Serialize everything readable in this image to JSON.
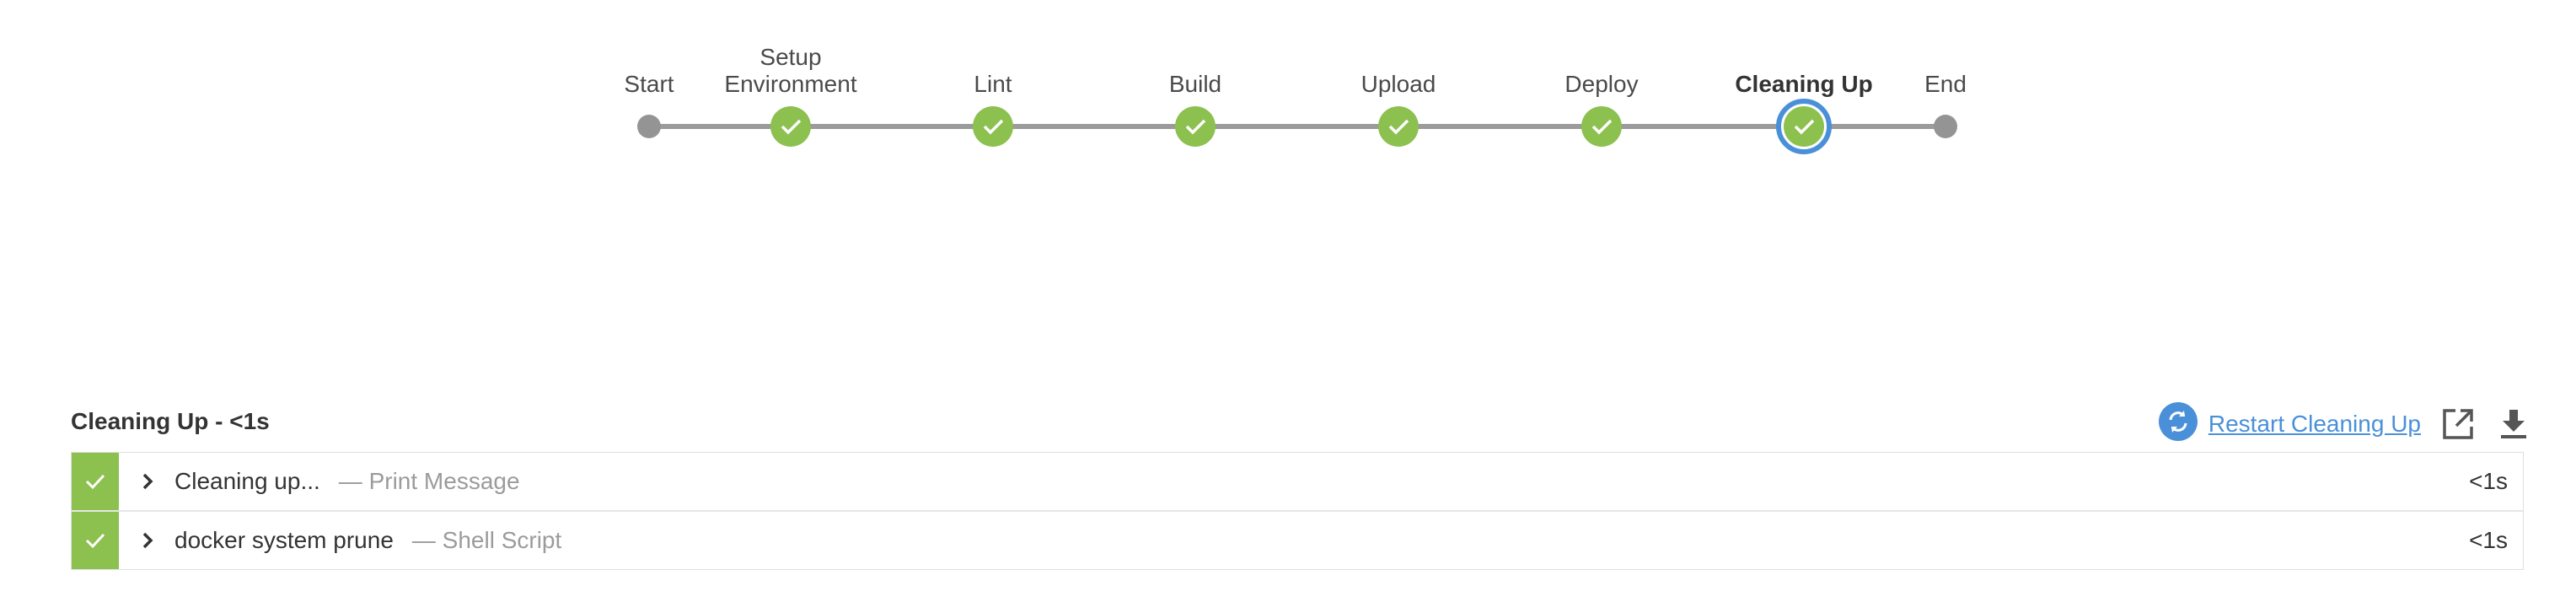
{
  "pipeline": {
    "stages": [
      {
        "label": "Start",
        "kind": "start"
      },
      {
        "label": "Setup\nEnvironment",
        "kind": "success"
      },
      {
        "label": "Lint",
        "kind": "success"
      },
      {
        "label": "Build",
        "kind": "success"
      },
      {
        "label": "Upload",
        "kind": "success"
      },
      {
        "label": "Deploy",
        "kind": "success"
      },
      {
        "label": "Cleaning Up",
        "kind": "success",
        "selected": true
      },
      {
        "label": "End",
        "kind": "end"
      }
    ],
    "colors": {
      "success": "#8cc04f",
      "line": "#9b9b9b",
      "node": "#949494",
      "selected_ring": "#4a90d9"
    }
  },
  "panel": {
    "title": "Cleaning Up - <1s",
    "restart_label": "Restart Cleaning Up",
    "icons": [
      "restart-icon",
      "open-external-icon",
      "download-icon"
    ]
  },
  "steps": [
    {
      "name": "Cleaning up...",
      "type": "— Print Message",
      "duration": "<1s",
      "status": "success"
    },
    {
      "name": "docker system prune",
      "type": "— Shell Script",
      "duration": "<1s",
      "status": "success"
    }
  ]
}
